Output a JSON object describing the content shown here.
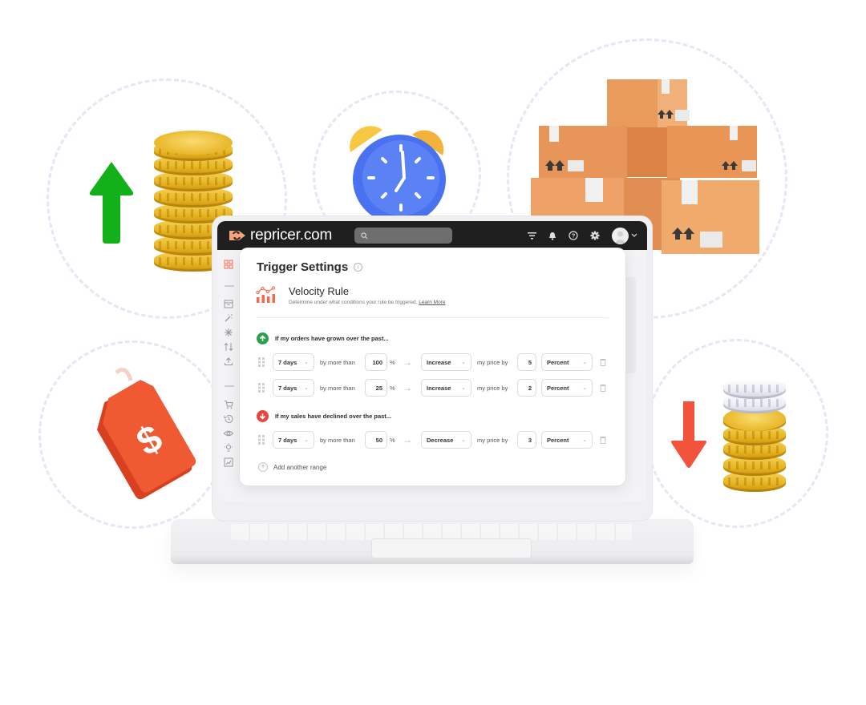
{
  "app": {
    "brand_name": "repricer.com",
    "accent_color": "#f36b4f"
  },
  "topbar": {
    "search_placeholder": "",
    "icons": [
      "filter-icon",
      "bell-icon",
      "help-icon",
      "gear-icon",
      "avatar",
      "chevron-down-icon"
    ]
  },
  "sidebar": {
    "icons": [
      "dashboard-icon",
      "archive-icon",
      "magic-wand-icon",
      "network-icon",
      "repricing-arrows-icon",
      "upload-icon",
      "cart-icon",
      "history-icon",
      "eye-icon",
      "lightbulb-icon",
      "report-icon"
    ]
  },
  "trigger": {
    "title": "Trigger Settings",
    "info_icon": "i",
    "rule_name": "Velocity Rule",
    "rule_description": "Determine under what conditions your rule be triggered.",
    "learn_more": "Learn More",
    "add_range": "Add another range",
    "sections": [
      {
        "heading": "If my orders have grown over the past...",
        "direction": "up",
        "color": "#2aa14a",
        "rows": [
          {
            "period": "7 days",
            "by_label": "by more than",
            "threshold": "100",
            "pct": "%",
            "action": "Increase",
            "price_label": "my price by",
            "amount": "5",
            "unit": "Percent"
          },
          {
            "period": "7 days",
            "by_label": "by more than",
            "threshold": "25",
            "pct": "%",
            "action": "Increase",
            "price_label": "my price by",
            "amount": "2",
            "unit": "Percent"
          }
        ]
      },
      {
        "heading": "If my sales have declined over the past...",
        "direction": "down",
        "color": "#e8453c",
        "rows": [
          {
            "period": "7 days",
            "by_label": "by more than",
            "threshold": "50",
            "pct": "%",
            "action": "Decrease",
            "price_label": "my price by",
            "amount": "3",
            "unit": "Percent"
          }
        ]
      }
    ]
  },
  "decorations": [
    "green-up-arrow",
    "gold-coin-stack",
    "alarm-clock",
    "cardboard-boxes",
    "price-tag",
    "red-down-arrow",
    "shrinking-coin-stack"
  ]
}
